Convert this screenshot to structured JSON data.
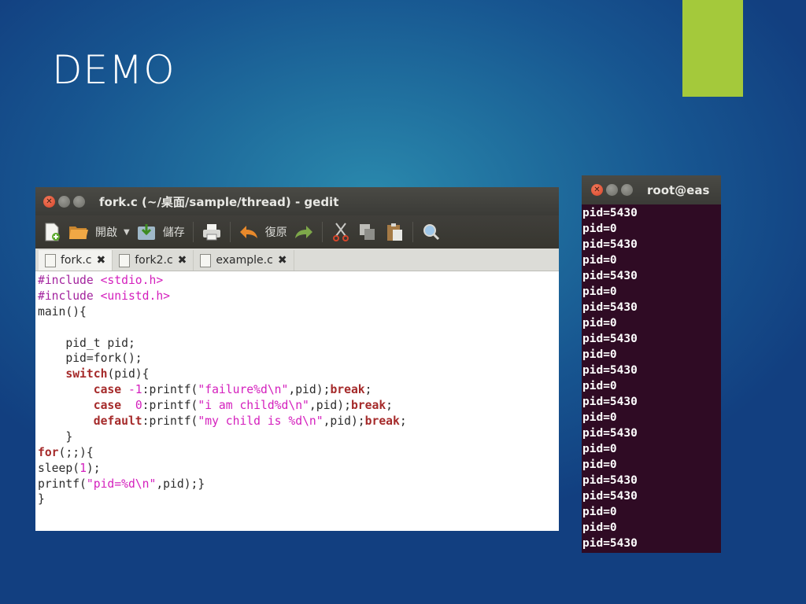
{
  "slide": {
    "title": "DEMO",
    "accent_color": "#a4c93b"
  },
  "gedit": {
    "window_title": "fork.c (~/桌面/sample/thread) - gedit",
    "toolbar": {
      "open_label": "開啟",
      "save_label": "儲存",
      "undo_label": "復原"
    },
    "tabs": [
      {
        "label": "fork.c"
      },
      {
        "label": "fork2.c"
      },
      {
        "label": "example.c"
      }
    ],
    "code_lines": [
      "#include <stdio.h>",
      "#include <unistd.h>",
      "main(){",
      "",
      "    pid_t pid;",
      "    pid=fork();",
      "    switch(pid){",
      "        case -1:printf(\"failure%d\\n\",pid);break;",
      "        case  0:printf(\"i am child%d\\n\",pid);break;",
      "        default:printf(\"my child is %d\\n\",pid);break;",
      "    }",
      "for(;;){",
      "sleep(1);",
      "printf(\"pid=%d\\n\",pid);}",
      "}"
    ]
  },
  "terminal": {
    "window_title": "root@eas",
    "output_lines": [
      "pid=5430",
      "pid=0",
      "pid=5430",
      "pid=0",
      "pid=5430",
      "pid=0",
      "pid=5430",
      "pid=0",
      "pid=5430",
      "pid=0",
      "pid=5430",
      "pid=0",
      "pid=5430",
      "pid=0",
      "pid=5430",
      "pid=0",
      "pid=0",
      "pid=5430",
      "pid=5430",
      "pid=0",
      "pid=0",
      "pid=5430"
    ]
  }
}
